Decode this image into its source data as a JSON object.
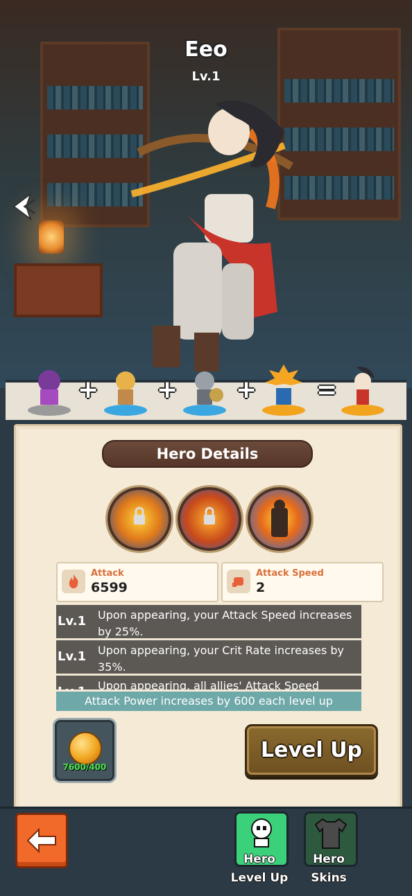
{
  "hero": {
    "name": "Eeo",
    "level": "Lv.1"
  },
  "merge": {
    "units": [
      "purple-mage",
      "blond-warrior",
      "shield-knight",
      "spiky-hair-lancer",
      "eeo-archer"
    ],
    "operators": [
      "+",
      "+",
      "+",
      "="
    ]
  },
  "panel": {
    "title": "Hero Details",
    "skills": [
      "skill-fire-slash",
      "skill-fire-shot",
      "skill-flame-aura"
    ],
    "stats": [
      {
        "label": "Attack",
        "value": "6599",
        "icon": "fire-icon"
      },
      {
        "label": "Attack Speed",
        "value": "2",
        "icon": "fist-icon"
      }
    ],
    "effects": [
      {
        "level": "Lv.1",
        "text": "Upon appearing, your Attack Speed increases by 25%."
      },
      {
        "level": "Lv.1",
        "text": "Upon appearing, your Crit Rate increases by 35%."
      },
      {
        "level": "Lv.1",
        "text": "Upon appearing, all allies' Attack Speed"
      }
    ],
    "levelup_note": "Attack Power increases by 600 each level up",
    "coin_count": "7600/400",
    "levelup_button": "Level Up"
  },
  "bottom": {
    "tabs": [
      {
        "line1": "Hero",
        "line2": "Level Up"
      },
      {
        "line1": "Hero",
        "line2": "Skins"
      }
    ]
  },
  "colors": {
    "accent_orange": "#f26a2a",
    "tab_active": "#3bd17a",
    "coin_count_green": "#4be34b"
  }
}
